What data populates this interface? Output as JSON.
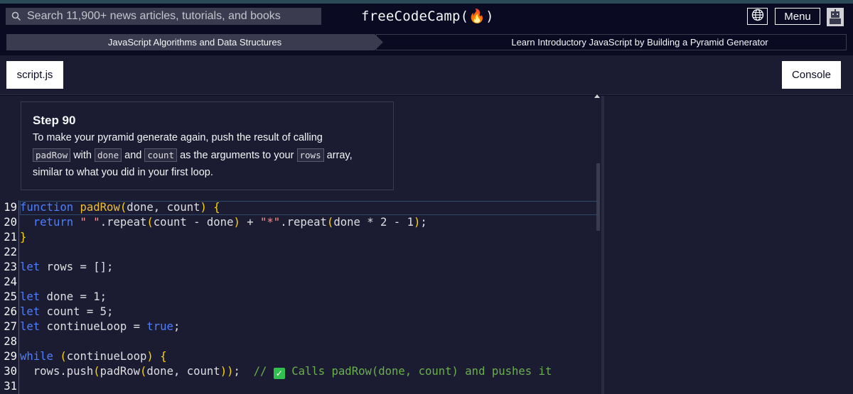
{
  "nav": {
    "search_placeholder": "Search 11,900+ news articles, tutorials, and books",
    "logo_text": "freeCodeCamp(🔥)",
    "menu_label": "Menu",
    "icons": {
      "search": "search-icon",
      "globe": "globe-icon",
      "avatar": "avatar-icon",
      "flame": "flame-icon"
    }
  },
  "breadcrumb": {
    "superblock": "JavaScript Algorithms and Data Structures",
    "block": "Learn Introductory JavaScript by Building a Pyramid Generator"
  },
  "tabs": {
    "script": "script.js",
    "console": "Console"
  },
  "step": {
    "title": "Step 90",
    "desc_part1": "To make your pyramid generate again, push the result of calling",
    "code1": "padRow",
    "desc_part2": "with",
    "code2": "done",
    "desc_part3": "and",
    "code3": "count",
    "desc_part4": "as the arguments to your",
    "code4": "rows",
    "desc_part5": "array,",
    "desc_part6": "similar to what you did in your first loop."
  },
  "code": {
    "line_numbers": [
      "19",
      "20",
      "21",
      "22",
      "23",
      "24",
      "25",
      "26",
      "27",
      "28",
      "29",
      "30",
      "31"
    ],
    "lines": [
      {
        "tokens": [
          [
            "kw",
            "function"
          ],
          [
            "op",
            " "
          ],
          [
            "fn",
            "padRow"
          ],
          [
            "br",
            "("
          ],
          [
            "op",
            "done, count"
          ],
          [
            "br",
            ")"
          ],
          [
            "op",
            " "
          ],
          [
            "br",
            "{"
          ]
        ]
      },
      {
        "tokens": [
          [
            "op",
            "  "
          ],
          [
            "kw",
            "return"
          ],
          [
            "op",
            " "
          ],
          [
            "st",
            "\" \""
          ],
          [
            "op",
            ".repeat"
          ],
          [
            "br",
            "("
          ],
          [
            "op",
            "count - done"
          ],
          [
            "br",
            ")"
          ],
          [
            "op",
            " + "
          ],
          [
            "st",
            "\"*\""
          ],
          [
            "op",
            ".repeat"
          ],
          [
            "br",
            "("
          ],
          [
            "op",
            "done * 2 - 1"
          ],
          [
            "br",
            ")"
          ],
          [
            "op",
            ";"
          ]
        ]
      },
      {
        "tokens": [
          [
            "br",
            "}"
          ]
        ]
      },
      {
        "tokens": []
      },
      {
        "tokens": [
          [
            "kw",
            "let"
          ],
          [
            "op",
            " rows = [];"
          ]
        ]
      },
      {
        "tokens": []
      },
      {
        "tokens": [
          [
            "kw",
            "let"
          ],
          [
            "op",
            " done = 1;"
          ]
        ]
      },
      {
        "tokens": [
          [
            "kw",
            "let"
          ],
          [
            "op",
            " count = 5;"
          ]
        ]
      },
      {
        "tokens": [
          [
            "kw",
            "let"
          ],
          [
            "op",
            " continueLoop = "
          ],
          [
            "kw",
            "true"
          ],
          [
            "op",
            ";"
          ]
        ]
      },
      {
        "tokens": []
      },
      {
        "tokens": [
          [
            "kw",
            "while"
          ],
          [
            "op",
            " "
          ],
          [
            "br",
            "("
          ],
          [
            "op",
            "continueLoop"
          ],
          [
            "br",
            ")"
          ],
          [
            "op",
            " "
          ],
          [
            "br",
            "{"
          ]
        ]
      },
      {
        "tokens": [
          [
            "op",
            "  rows.push"
          ],
          [
            "br",
            "("
          ],
          [
            "op",
            "padRow"
          ],
          [
            "br",
            "("
          ],
          [
            "op",
            "done, count"
          ],
          [
            "br",
            "))"
          ],
          [
            "op",
            ";  "
          ],
          [
            "cm",
            "// "
          ],
          [
            "check",
            "✓"
          ],
          [
            "cm",
            " Calls padRow(done, count) and pushes it"
          ]
        ]
      },
      {
        "tokens": []
      }
    ]
  }
}
